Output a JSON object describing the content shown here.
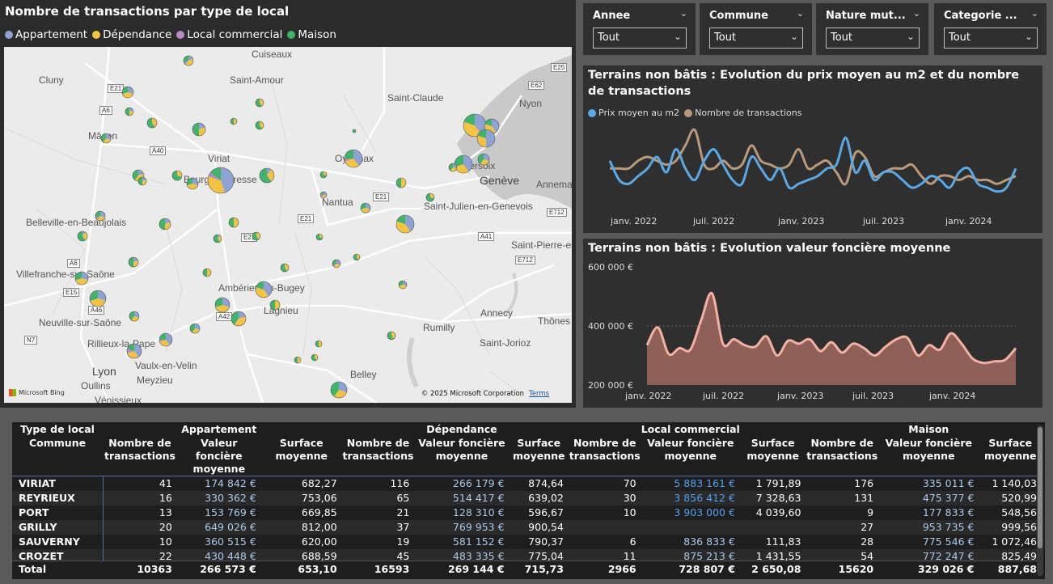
{
  "map": {
    "title": "Nombre de transactions par type de local",
    "legend": [
      {
        "label": "Appartement",
        "color": "#8fa2d4"
      },
      {
        "label": "Dépendance",
        "color": "#f5c342"
      },
      {
        "label": "Local commercial",
        "color": "#b98bc4"
      },
      {
        "label": "Maison",
        "color": "#3fb46a"
      }
    ],
    "cities": [
      "Cuiseaux",
      "Cluny",
      "Saint-Amour",
      "Saint-Claude",
      "Nyon",
      "Mâcon",
      "Viriat",
      "Oyonnax",
      "Versoix",
      "Bourg-en-Bresse",
      "Genève",
      "Annemasse",
      "Nantua",
      "Saint-Julien-en-Genevois",
      "Belleville-en-Beaujolais",
      "Saint-Pierre-en-Faucigny",
      "Villefranche-sur-Saône",
      "Ambérieu-en-Bugey",
      "Lagnieu",
      "Annecy",
      "Neuville-sur-Saône",
      "Thônes",
      "Rumilly",
      "Rillieux-la-Pape",
      "Saint-Jorioz",
      "Lyon",
      "Vaulx-en-Velin",
      "Meyzieu",
      "Oullins",
      "Belley",
      "Vénissieux"
    ],
    "roads": [
      "E25",
      "E21",
      "E62",
      "A6",
      "A40",
      "E21",
      "E21",
      "E712",
      "A41",
      "E712",
      "A6",
      "E15",
      "A46",
      "A42",
      "N7",
      "E21"
    ],
    "bing": "Microsoft Bing",
    "copyright": "© 2025 Microsoft Corporation",
    "terms": "Terms"
  },
  "slicers": [
    {
      "label": "Annee",
      "value": "Tout"
    },
    {
      "label": "Commune",
      "value": "Tout"
    },
    {
      "label": "Nature mut...",
      "value": "Tout"
    },
    {
      "label": "Categorie ...",
      "value": "Tout"
    }
  ],
  "colors": {
    "prix": "#5aa9e6",
    "nombre": "#b89a7a",
    "area_line": "#f4b0a3",
    "area_fill": "#a0685e",
    "blue": "#4fa0ee"
  },
  "chart_data": [
    {
      "type": "line",
      "title": "Terrains non bâtis : Evolution du prix moyen au m2 et du nombre de transactions",
      "x_labels": [
        "janv. 2022",
        "juil. 2022",
        "janv. 2023",
        "juil. 2023",
        "janv. 2024"
      ],
      "series": [
        {
          "name": "Prix moyen au m2",
          "values": [
            0.55,
            0.3,
            0.25,
            0.35,
            0.45,
            0.6,
            0.4,
            0.7,
            0.45,
            0.3,
            0.55,
            0.7,
            0.5,
            0.3,
            0.25,
            0.6,
            0.45,
            0.3,
            0.45,
            0.2,
            0.25,
            0.3,
            0.35,
            0.45,
            0.5,
            0.85,
            0.4,
            0.55,
            0.3,
            0.4,
            0.4,
            0.3,
            0.2,
            0.25,
            0.35,
            0.3,
            0.2,
            0.4,
            0.45,
            0.25,
            0.2,
            0.15,
            0.2,
            0.45
          ]
        },
        {
          "name": "Nombre de transactions",
          "values": [
            0.45,
            0.45,
            0.45,
            0.55,
            0.6,
            0.55,
            0.5,
            0.55,
            0.75,
            0.95,
            0.5,
            0.45,
            0.55,
            0.45,
            0.5,
            0.75,
            0.55,
            0.5,
            0.45,
            0.5,
            0.7,
            0.45,
            0.5,
            0.55,
            0.4,
            0.25,
            0.65,
            0.6,
            0.35,
            0.4,
            0.45,
            0.45,
            0.5,
            0.35,
            0.25,
            0.35,
            0.35,
            0.3,
            0.35,
            0.3,
            0.3,
            0.25,
            0.3,
            0.35
          ]
        }
      ]
    },
    {
      "type": "area",
      "title": "Terrains non bâtis : Evolution valeur foncière moyenne",
      "x_labels": [
        "janv. 2022",
        "juil. 2022",
        "janv. 2023",
        "juil. 2023",
        "janv. 2024"
      ],
      "y_ticks": [
        "600 000 €",
        "400 000 €",
        "200 000 €"
      ],
      "ylim": [
        200000,
        600000
      ],
      "values": [
        335000,
        395000,
        305000,
        325000,
        320000,
        420000,
        510000,
        340000,
        355000,
        335000,
        330000,
        365000,
        300000,
        350000,
        340000,
        355000,
        315000,
        345000,
        310000,
        340000,
        325000,
        300000,
        330000,
        355000,
        360000,
        300000,
        335000,
        320000,
        375000,
        340000,
        290000,
        275000,
        280000,
        285000,
        325000
      ]
    }
  ],
  "table": {
    "header_groups": [
      "Appartement",
      "Dépendance",
      "Local commercial",
      "Maison"
    ],
    "type_label": "Type de local",
    "commune_label": "Commune",
    "sub_headers": [
      "Nombre de transactions",
      "Valeur foncière moyenne",
      "Surface moyenne"
    ],
    "rows": [
      {
        "commune": "VIRIAT",
        "c": [
          "41",
          "174 842 €",
          "682,27",
          "116",
          "266 179 €",
          "874,64",
          "70",
          "5 883 161 €",
          "1 791,89",
          "176",
          "335 011 €",
          "1 140,03"
        ]
      },
      {
        "commune": "REYRIEUX",
        "c": [
          "16",
          "330 362 €",
          "753,06",
          "65",
          "514 417 €",
          "639,02",
          "30",
          "3 856 412 €",
          "7 328,63",
          "131",
          "475 377 €",
          "520,99"
        ]
      },
      {
        "commune": "PORT",
        "c": [
          "13",
          "153 769 €",
          "669,85",
          "21",
          "128 310 €",
          "596,67",
          "10",
          "3 903 000 €",
          "4 039,60",
          "9",
          "177 833 €",
          "548,56"
        ]
      },
      {
        "commune": "GRILLY",
        "c": [
          "20",
          "649 026 €",
          "812,00",
          "37",
          "769 953 €",
          "900,54",
          "",
          "",
          "",
          "27",
          "953 735 €",
          "999,56"
        ]
      },
      {
        "commune": "SAUVERNY",
        "c": [
          "10",
          "360 515 €",
          "620,00",
          "19",
          "581 152 €",
          "790,37",
          "6",
          "836 833 €",
          "111,83",
          "28",
          "775 546 €",
          "1 072,46"
        ]
      },
      {
        "commune": "CROZET",
        "c": [
          "22",
          "430 448 €",
          "688,59",
          "45",
          "483 335 €",
          "775,04",
          "11",
          "875 213 €",
          "1 431,55",
          "54",
          "772 247 €",
          "825,49"
        ]
      }
    ],
    "total": {
      "label": "Total",
      "c": [
        "10363",
        "266 573 €",
        "653,10",
        "16593",
        "269 144 €",
        "715,73",
        "2966",
        "728 807 €",
        "2 650,08",
        "15620",
        "329 026 €",
        "887,68"
      ]
    }
  }
}
